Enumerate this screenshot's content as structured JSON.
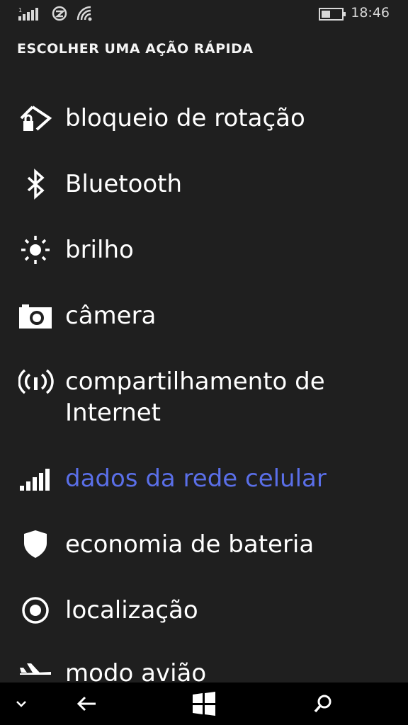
{
  "status_bar": {
    "time": "18:46",
    "icons": [
      "cellular-signal-icon",
      "data-connection-icon",
      "wifi-icon",
      "battery-icon"
    ]
  },
  "page": {
    "title": "ESCOLHER UMA AÇÃO RÁPIDA"
  },
  "actions": [
    {
      "label": "bloqueio de rotação",
      "icon": "rotation-lock-icon"
    },
    {
      "label": "Bluetooth",
      "icon": "bluetooth-icon"
    },
    {
      "label": "brilho",
      "icon": "brightness-icon"
    },
    {
      "label": "câmera",
      "icon": "camera-icon"
    },
    {
      "label": "compartilhamento de Internet",
      "icon": "hotspot-icon"
    },
    {
      "label": "dados da rede celular",
      "icon": "cellular-data-icon",
      "selected": true
    },
    {
      "label": "economia de bateria",
      "icon": "battery-saver-icon"
    },
    {
      "label": "localização",
      "icon": "location-icon"
    },
    {
      "label": "modo avião",
      "icon": "airplane-icon"
    }
  ],
  "colors": {
    "background": "#1f1f1f",
    "accent": "#5a6fe8",
    "text": "#ffffff",
    "nav_bar": "#000000"
  },
  "nav_bar": {
    "icons": [
      "chevron-down-icon",
      "back-arrow-icon",
      "windows-start-icon",
      "search-icon"
    ]
  }
}
